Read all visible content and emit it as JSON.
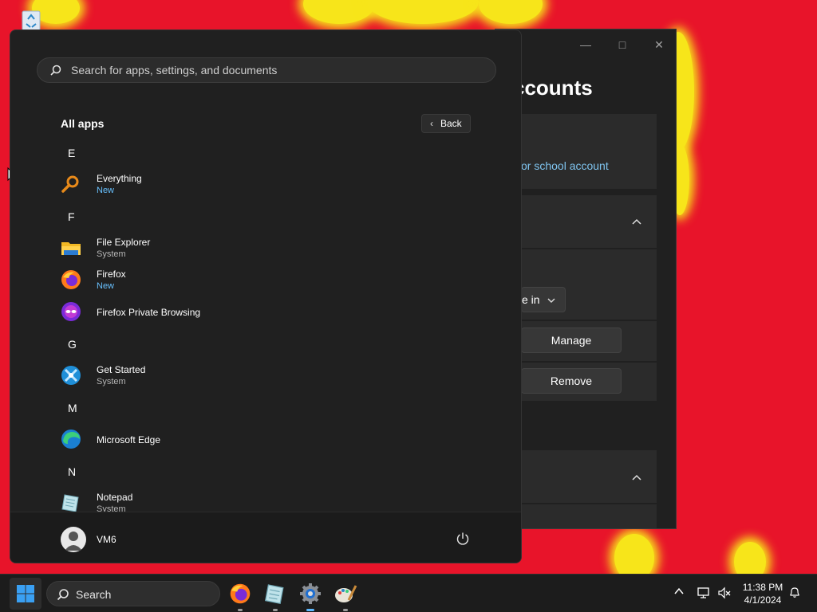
{
  "settings_window": {
    "title": "ccounts",
    "link": "or school account",
    "dropdown_label": "e in",
    "manage_label": "Manage",
    "remove_label": "Remove"
  },
  "start_menu": {
    "search_placeholder": "Search for apps, settings, and documents",
    "all_apps_title": "All apps",
    "back_label": "Back",
    "sections": [
      {
        "letter": "E",
        "apps": [
          {
            "name": "Everything",
            "sub": "New"
          }
        ]
      },
      {
        "letter": "F",
        "apps": [
          {
            "name": "File Explorer",
            "sub": "System"
          },
          {
            "name": "Firefox",
            "sub": "New"
          },
          {
            "name": "Firefox Private Browsing",
            "sub": ""
          }
        ]
      },
      {
        "letter": "G",
        "apps": [
          {
            "name": "Get Started",
            "sub": "System"
          }
        ]
      },
      {
        "letter": "M",
        "apps": [
          {
            "name": "Microsoft Edge",
            "sub": ""
          }
        ]
      },
      {
        "letter": "N",
        "apps": [
          {
            "name": "Notepad",
            "sub": "System"
          }
        ]
      }
    ],
    "user_name": "VM6"
  },
  "taskbar": {
    "search_label": "Search",
    "time": "11:38 PM",
    "date": "4/1/2024"
  },
  "colors": {
    "desktop_bg": "#e8142a",
    "accent_link": "#68c1ff"
  }
}
